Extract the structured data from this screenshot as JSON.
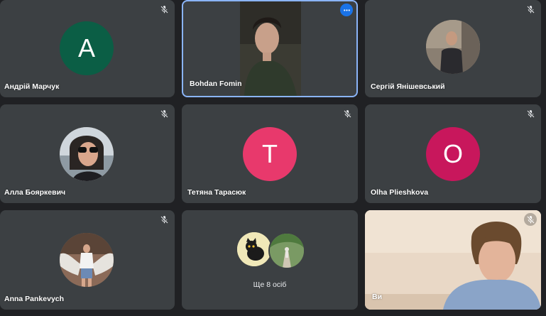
{
  "participants": [
    {
      "name": "Андрій Марчук",
      "initial": "A",
      "color": "#0b5e45",
      "muted": true
    },
    {
      "name": "Bohdan Fomin",
      "active_speaker": true,
      "menu_icon": "more-horiz-icon"
    },
    {
      "name": "Сергій Янішевський",
      "muted": true
    },
    {
      "name": "Алла Бояркевич",
      "muted": true
    },
    {
      "name": "Тетяна Тарасюк",
      "initial": "T",
      "color": "#e8396c",
      "muted": true
    },
    {
      "name": "Olha Plieshkova",
      "initial": "O",
      "color": "#c8175c",
      "muted": true
    },
    {
      "name": "Anna Pankevych",
      "muted": true
    },
    {
      "others_label": "Ще 8 осіб"
    },
    {
      "name": "Ви",
      "muted": true,
      "self_view": true
    }
  ],
  "colors": {
    "background": "#202124",
    "tile": "#3c4043",
    "active_border": "#8ab4f8",
    "menu_button": "#1a73e8"
  },
  "icons": {
    "muted": "mic-off-icon",
    "menu": "more-horiz-icon"
  }
}
